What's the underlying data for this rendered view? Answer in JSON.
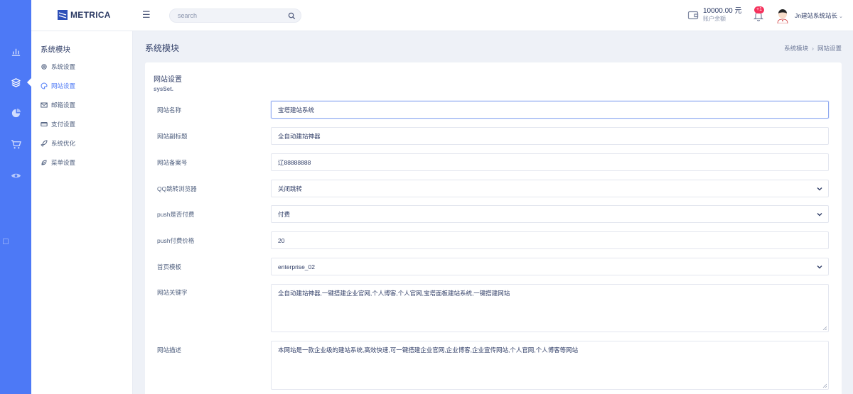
{
  "brand": {
    "name": "METRICA"
  },
  "search": {
    "placeholder": "search"
  },
  "account": {
    "balance": "10000.00 元",
    "balance_label": "账户余额",
    "notification_count": "+1",
    "username": "Jn建站系统站长"
  },
  "rail": {
    "icons": [
      "bar-chart-icon",
      "layers-icon",
      "pie-chart-icon",
      "cart-icon",
      "eye-icon"
    ]
  },
  "subnav": {
    "title": "系统模块",
    "items": [
      {
        "label": "系统设置",
        "icon": "gear-icon"
      },
      {
        "label": "网站设置",
        "icon": "palette-icon",
        "active": true
      },
      {
        "label": "邮箱设置",
        "icon": "mail-icon"
      },
      {
        "label": "支付设置",
        "icon": "card-icon"
      },
      {
        "label": "系统优化",
        "icon": "rocket-icon"
      },
      {
        "label": "菜单设置",
        "icon": "leaf-icon"
      }
    ]
  },
  "page": {
    "title": "系统模块",
    "breadcrumb": [
      "系统模块",
      "网站设置"
    ]
  },
  "form": {
    "title": "网站设置",
    "subtitle": "sysSet.",
    "fields": [
      {
        "label": "网站名称",
        "value": "宝塔建站系统"
      },
      {
        "label": "网站副标题",
        "value": "全自动建站神器"
      },
      {
        "label": "网站备案号",
        "value": "辽88888888"
      },
      {
        "label": "QQ跳转浏览器",
        "value": "关闭跳转"
      },
      {
        "label": "push是否付费",
        "value": "付费"
      },
      {
        "label": "push付费价格",
        "value": "20"
      },
      {
        "label": "首页模板",
        "value": "enterprise_02"
      },
      {
        "label": "网站关键字",
        "value": "全自动建站神器,一键搭建企业官网,个人博客,个人官网,宝塔面板建站系统,一键搭建网站"
      },
      {
        "label": "网站描述",
        "value": "本网站是一款企业级的建站系统,高效快速,可一键搭建企业官网,企业博客,企业宣传网站,个人官网,个人博客等网站"
      }
    ]
  },
  "colors": {
    "accent": "#4d79f6",
    "background": "#eef1f7",
    "badge": "#f5325c"
  }
}
